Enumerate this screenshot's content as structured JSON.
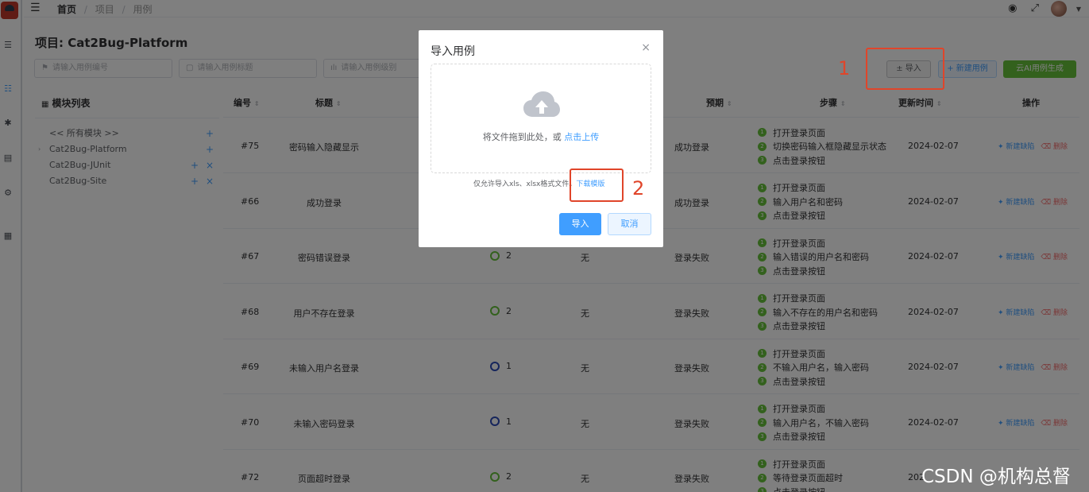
{
  "breadcrumb": {
    "home": "首页",
    "items": [
      "项目",
      "用例"
    ]
  },
  "page_title": "项目: Cat2Bug-Platform",
  "filters": [
    {
      "icon": "flag-icon",
      "placeholder": "请输入用例编号"
    },
    {
      "icon": "search-icon",
      "placeholder": "请输入用例标题"
    },
    {
      "icon": "level-icon",
      "placeholder": "请输入用例级别"
    }
  ],
  "toolbar": {
    "import": "± 导入",
    "new_case": "+ 新建用例",
    "ai_gen": "云AI用例生成"
  },
  "annotations": {
    "one": "1",
    "two": "2"
  },
  "modules": {
    "title": "模块列表",
    "items": [
      {
        "label": "<< 所有模块 >>",
        "actions": "+"
      },
      {
        "label": "Cat2Bug-Platform",
        "actions": "+",
        "expandable": true
      },
      {
        "label": "Cat2Bug-JUnit",
        "actions": "+ ×"
      },
      {
        "label": "Cat2Bug-Site",
        "actions": "+ ×"
      }
    ]
  },
  "table": {
    "columns": {
      "no": "编号",
      "title": "标题",
      "expect": "预期",
      "steps": "步骤",
      "time": "更新时间",
      "ops": "操作"
    },
    "rows": [
      {
        "no": "#75",
        "title": "密码输入隐藏显示",
        "level": "",
        "pre": "",
        "expect": "成功登录",
        "steps": [
          "打开登录页面",
          "切换密码输入框隐藏显示状态",
          "点击登录按钮"
        ],
        "time": "2024-02-07",
        "op_bug": "新建缺陷",
        "op_del": "删除"
      },
      {
        "no": "#66",
        "title": "成功登录",
        "level": "",
        "pre": "",
        "expect": "成功登录",
        "steps": [
          "打开登录页面",
          "输入用户名和密码",
          "点击登录按钮"
        ],
        "time": "2024-02-07",
        "op_bug": "新建缺陷",
        "op_del": "删除"
      },
      {
        "no": "#67",
        "title": "密码错误登录",
        "level": "2",
        "ring": "green",
        "pre": "无",
        "expect": "登录失败",
        "steps": [
          "打开登录页面",
          "输入错误的用户名和密码",
          "点击登录按钮"
        ],
        "time": "2024-02-07",
        "op_bug": "新建缺陷",
        "op_del": "删除"
      },
      {
        "no": "#68",
        "title": "用户不存在登录",
        "level": "2",
        "ring": "green",
        "pre": "无",
        "expect": "登录失败",
        "steps": [
          "打开登录页面",
          "输入不存在的用户名和密码",
          "点击登录按钮"
        ],
        "time": "2024-02-07",
        "op_bug": "新建缺陷",
        "op_del": "删除"
      },
      {
        "no": "#69",
        "title": "未输入用户名登录",
        "level": "1",
        "ring": "blue",
        "pre": "无",
        "expect": "登录失败",
        "steps": [
          "打开登录页面",
          "不输入用户名，输入密码",
          "点击登录按钮"
        ],
        "time": "2024-02-07",
        "op_bug": "新建缺陷",
        "op_del": "删除"
      },
      {
        "no": "#70",
        "title": "未输入密码登录",
        "level": "1",
        "ring": "blue",
        "pre": "无",
        "expect": "登录失败",
        "steps": [
          "打开登录页面",
          "输入用户名，不输入密码",
          "点击登录按钮"
        ],
        "time": "2024-02-07",
        "op_bug": "新建缺陷",
        "op_del": "删除"
      },
      {
        "no": "#72",
        "title": "页面超时登录",
        "level": "2",
        "ring": "green",
        "pre": "无",
        "expect": "登录失败",
        "steps": [
          "打开登录页面",
          "等待登录页面超时",
          "点击登录按钮"
        ],
        "time": "202",
        "op_bug": "",
        "op_del": ""
      }
    ]
  },
  "dialog": {
    "title": "导入用例",
    "drop_text": "将文件拖到此处，或",
    "drop_link": "点击上传",
    "tip": "仅允许导入xls、xlsx格式文件。",
    "tip_link": "下载模版",
    "ok": "导入",
    "cancel": "取消"
  },
  "watermark": "CSDN @机构总督"
}
